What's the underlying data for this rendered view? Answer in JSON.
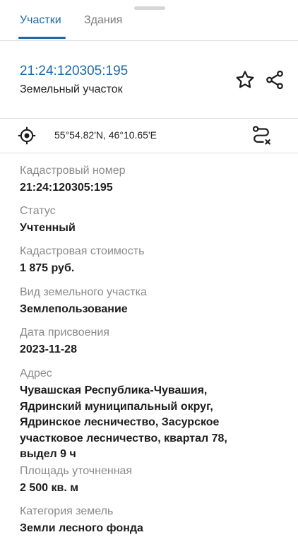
{
  "tabs": [
    {
      "label": "Участки"
    },
    {
      "label": "Здания"
    }
  ],
  "parcel": {
    "id": "21:24:120305:195",
    "type": "Земельный участок"
  },
  "coordinates": "55°54.82'N, 46°10.65'E",
  "icons": {
    "favorite": "star-icon",
    "share": "share-icon",
    "location": "crosshair-icon",
    "route": "route-icon"
  },
  "fields": [
    {
      "label": "Кадастровый номер",
      "value": "21:24:120305:195"
    },
    {
      "label": "Статус",
      "value": "Учтенный"
    },
    {
      "label": "Кадастровая стоимость",
      "value": "1 875 руб."
    },
    {
      "label": "Вид земельного участка",
      "value": "Землепользование"
    },
    {
      "label": "Дата присвоения",
      "value": "2023-11-28"
    },
    {
      "label": "Адрес",
      "value_lines": [
        "Чувашская Республика-Чувашия,",
        "Ядринский муниципальный округ,",
        "Ядринское лесничество, Засурское",
        "участковое лесничество, квартал 78,",
        "выдел 9 ч"
      ]
    },
    {
      "label": "Площадь уточненная",
      "value": "2 500 кв. м"
    },
    {
      "label": "Категория земель",
      "value": "Земли лесного фонда"
    }
  ],
  "colors": {
    "accent": "#1c6aa8",
    "label": "#8a8a8a",
    "text": "#1d1d1f"
  }
}
